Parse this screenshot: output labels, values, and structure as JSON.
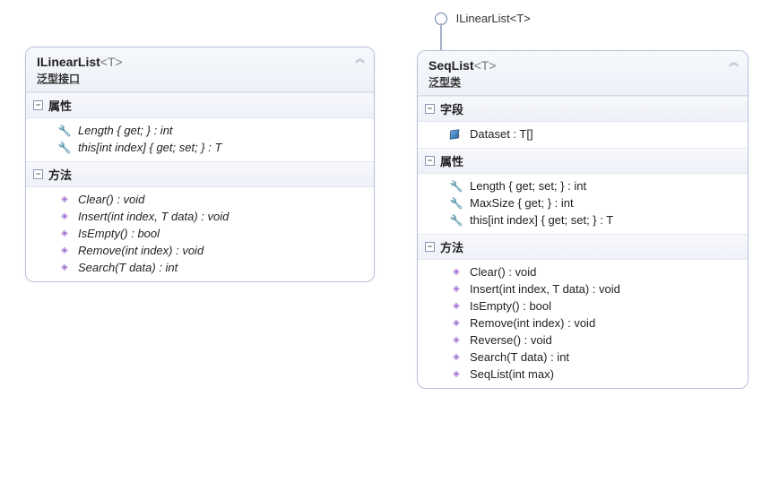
{
  "lollipop": {
    "label": "ILinearList<T>"
  },
  "left": {
    "title": "ILinearList",
    "generic": "<T>",
    "subtitle": "泛型接口",
    "sections": [
      {
        "name": "属性",
        "italic": true,
        "kind": "property",
        "members": [
          "Length { get; } : int",
          "this[int index] { get; set; } : T"
        ]
      },
      {
        "name": "方法",
        "italic": true,
        "kind": "method",
        "members": [
          "Clear() : void",
          "Insert(int index, T data) : void",
          "IsEmpty() : bool",
          "Remove(int index) : void",
          "Search(T data) : int"
        ]
      }
    ]
  },
  "right": {
    "title": "SeqList",
    "generic": "<T>",
    "subtitle": "泛型类",
    "sections": [
      {
        "name": "字段",
        "italic": false,
        "kind": "field",
        "members": [
          "Dataset : T[]"
        ]
      },
      {
        "name": "属性",
        "italic": false,
        "kind": "property",
        "members": [
          "Length { get; set; } : int",
          "MaxSize { get; } : int",
          "this[int index] { get; set; } : T"
        ]
      },
      {
        "name": "方法",
        "italic": false,
        "kind": "method",
        "members": [
          "Clear() : void",
          "Insert(int index, T data) : void",
          "IsEmpty() : bool",
          "Remove(int index) : void",
          "Reverse() : void",
          "Search(T data) : int",
          "SeqList(int max)"
        ]
      }
    ]
  }
}
